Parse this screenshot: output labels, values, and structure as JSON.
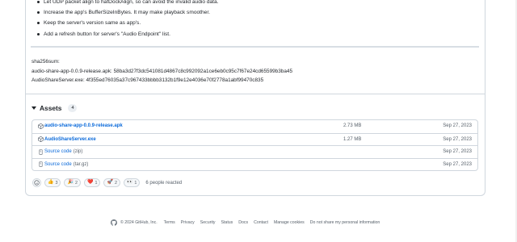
{
  "release_notes": {
    "bullets": [
      "Let UDP packet align to hafDockAlign, so can avoid the invalid audio data.",
      "Increase the app's BufferSizeInBytes. It may make playback smoother.",
      "Keep the server's version same as app's.",
      "Add a refresh button for server's \"Audio Endpoint\" list."
    ],
    "sha_label": "sha256sum:",
    "sha_lines": [
      "audio-share-app-0.0.9-release.apk: 58ba3d27f3dc541081d4867c8c992092a1ce6eb0c95c7f67e24cd65599b3ba45",
      "AudioShareServer.exe: 4f355ed76035a37c967433bbbb3132b1f9e12e4036e70f2778a1abf99470c835"
    ]
  },
  "assets": {
    "title": "Assets",
    "count": "4",
    "rows": [
      {
        "name": "audio-share-app-0.0.9-release.apk",
        "sub": "",
        "size": "2.73 MB",
        "date": "Sep 27, 2023",
        "icon": "package-icon"
      },
      {
        "name": "AudioShareServer.exe",
        "sub": "",
        "size": "1.27 MB",
        "date": "Sep 27, 2023",
        "icon": "package-icon"
      },
      {
        "name": "Source code",
        "sub": "(zip)",
        "size": "",
        "date": "Sep 27, 2023",
        "icon": "file-zip-icon"
      },
      {
        "name": "Source code",
        "sub": "(tar.gz)",
        "size": "",
        "date": "Sep 27, 2023",
        "icon": "file-zip-icon"
      }
    ]
  },
  "reactions": {
    "items": [
      {
        "emoji": "👍",
        "count": "3",
        "name": "thumbs-up"
      },
      {
        "emoji": "🎉",
        "count": "2",
        "name": "hooray"
      },
      {
        "emoji": "❤️",
        "count": "1",
        "name": "heart"
      },
      {
        "emoji": "🚀",
        "count": "2",
        "name": "rocket"
      },
      {
        "emoji": "👀",
        "count": "1",
        "name": "eyes"
      }
    ],
    "people": "6 people reacted"
  },
  "footer": {
    "copyright": "© 2024 GitHub, Inc.",
    "links": [
      "Terms",
      "Privacy",
      "Security",
      "Status",
      "Docs",
      "Contact",
      "Manage cookies",
      "Do not share my personal information"
    ]
  }
}
